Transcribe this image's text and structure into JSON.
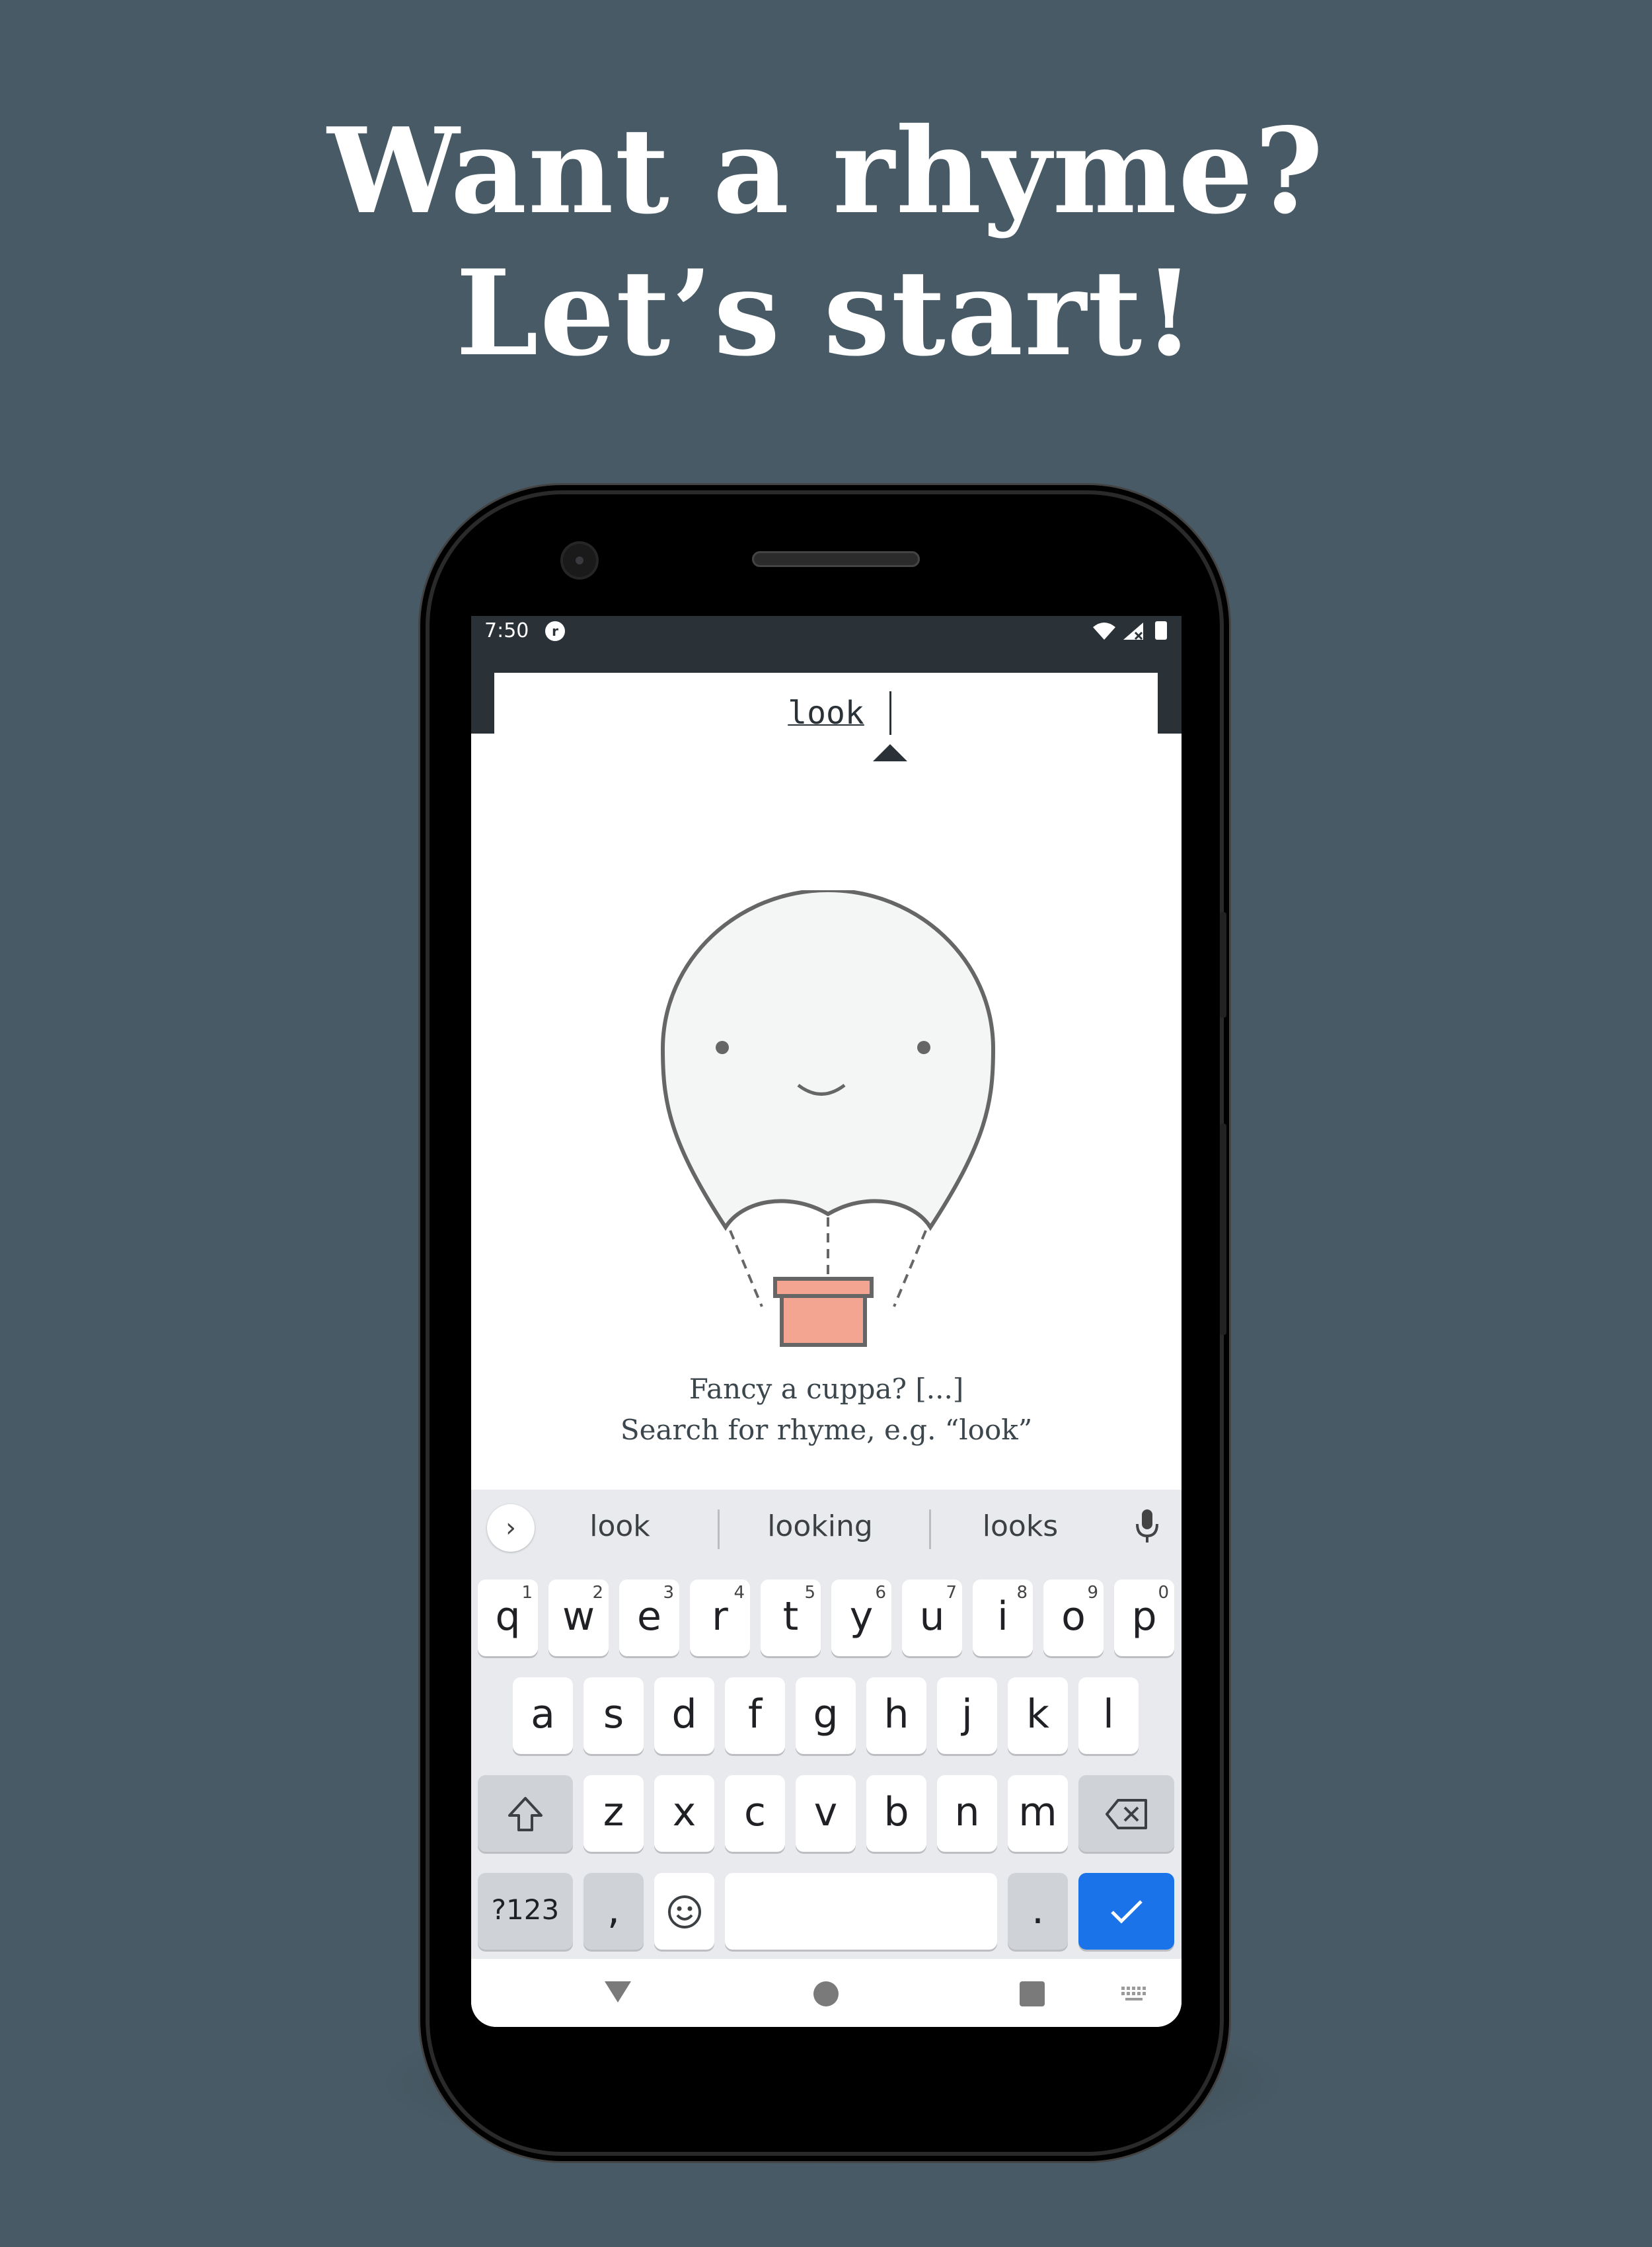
{
  "headline": {
    "line1": "Want a rhyme?",
    "line2": "Let’s start!"
  },
  "status_bar": {
    "time": "7:50",
    "app_icon_letter": "r"
  },
  "search": {
    "value": "look"
  },
  "illustration": {
    "name": "hot-air balloon with smiling face"
  },
  "caption": {
    "line1": "Fancy a cuppa? [...]",
    "line2": "Search for rhyme, e.g. “look”"
  },
  "keyboard": {
    "suggestions": [
      "look",
      "looking",
      "looks"
    ],
    "row1": [
      {
        "k": "q",
        "h": "1"
      },
      {
        "k": "w",
        "h": "2"
      },
      {
        "k": "e",
        "h": "3"
      },
      {
        "k": "r",
        "h": "4"
      },
      {
        "k": "t",
        "h": "5"
      },
      {
        "k": "y",
        "h": "6"
      },
      {
        "k": "u",
        "h": "7"
      },
      {
        "k": "i",
        "h": "8"
      },
      {
        "k": "o",
        "h": "9"
      },
      {
        "k": "p",
        "h": "0"
      }
    ],
    "row2": [
      "a",
      "s",
      "d",
      "f",
      "g",
      "h",
      "j",
      "k",
      "l"
    ],
    "row3": [
      "z",
      "x",
      "c",
      "v",
      "b",
      "n",
      "m"
    ],
    "symbols_label": "?123",
    "comma_label": ",",
    "period_label": "."
  },
  "colors": {
    "background": "#485a65",
    "app_bar": "#2a3238",
    "balloon_fill": "#f4f5f5",
    "balloon_stroke": "#666666",
    "basket": "#f4a592",
    "enter_key": "#1a73e8"
  }
}
